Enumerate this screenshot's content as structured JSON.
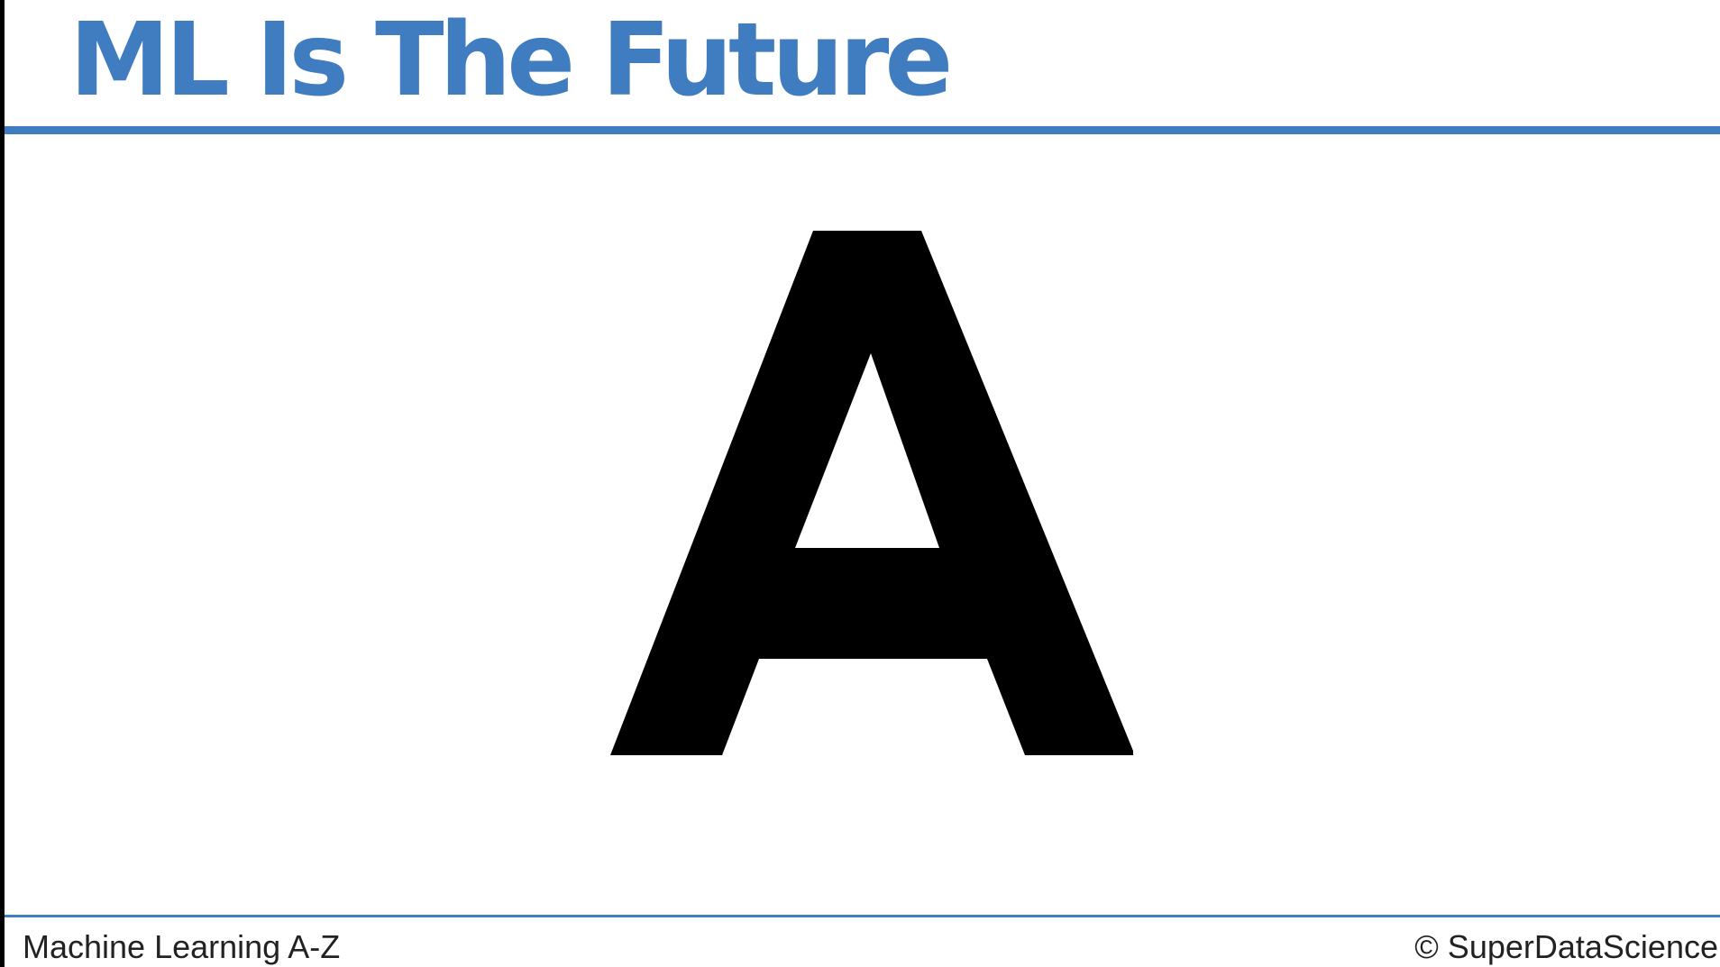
{
  "slide": {
    "title": "ML Is The Future",
    "main_letter": "A",
    "footer_left": "Machine Learning A-Z",
    "footer_right": "© SuperDataScience"
  },
  "colors": {
    "accent": "#3f7cc0",
    "text": "#000000",
    "background": "#ffffff"
  }
}
